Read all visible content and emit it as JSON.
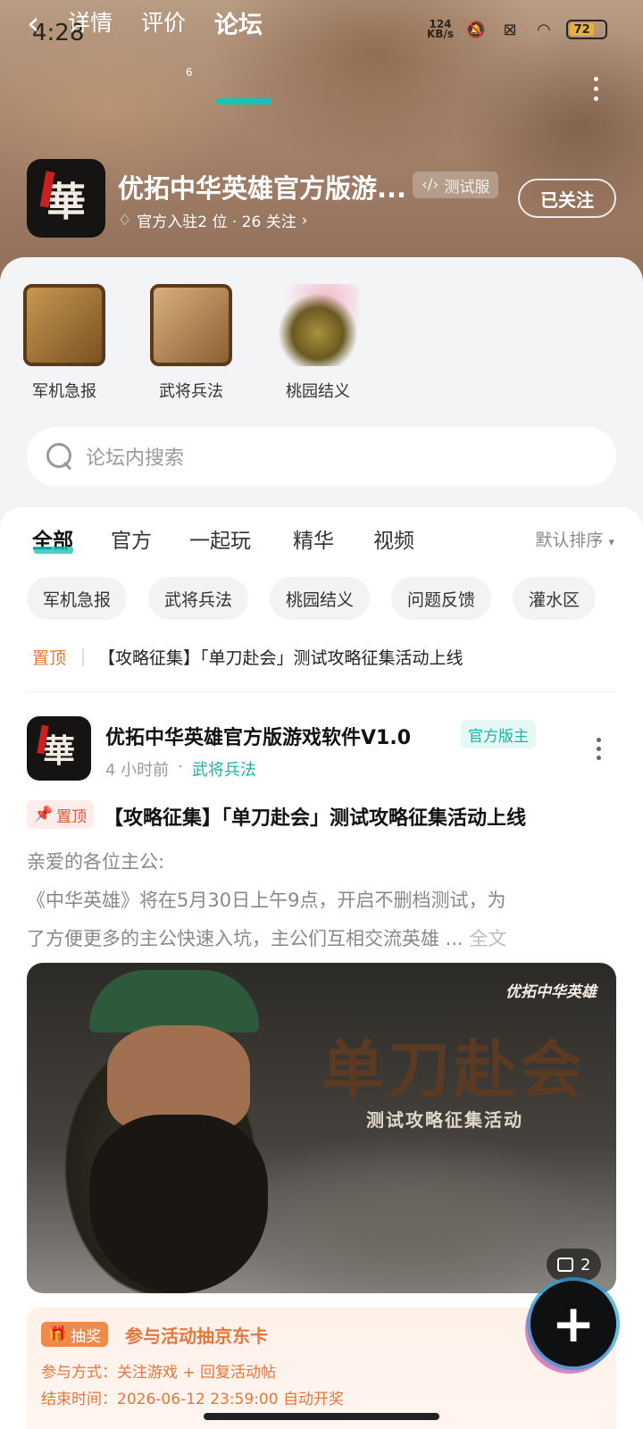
{
  "status": {
    "time": "4:28",
    "netspeed_top": "124",
    "netspeed_unit": "KB/s",
    "battery": "72"
  },
  "nav": {
    "tabs": [
      "详情",
      "评价",
      "论坛"
    ],
    "review_count": "6",
    "active_tab": "论坛"
  },
  "app": {
    "title": "优拓中华英雄官方版游...",
    "test_badge": "测试服",
    "follow_label": "已关注",
    "sub": "官方入驻2 位 · 26 关注",
    "logo_text": "華"
  },
  "quick_links": [
    {
      "label": "军机急报"
    },
    {
      "label": "武将兵法"
    },
    {
      "label": "桃园结义"
    }
  ],
  "search": {
    "placeholder": "论坛内搜索"
  },
  "filter_tabs": [
    "全部",
    "官方",
    "一起玩",
    "精华",
    "视频"
  ],
  "sort_label": "默认排序",
  "chips": [
    "军机急报",
    "武将兵法",
    "桃园结义",
    "问题反馈",
    "灌水区"
  ],
  "pinned": {
    "label": "置顶",
    "text": "【攻略征集】「单刀赴会」测试攻略征集活动上线"
  },
  "post": {
    "author": "优拓中华英雄官方版游戏软件V1.0",
    "owner_badge": "官方版主",
    "time": "4 小时前",
    "category": "武将兵法",
    "top_badge": "置顶",
    "title": "【攻略征集】「单刀赴会」测试攻略征集活动上线",
    "body_line1": "亲爱的各位主公:",
    "body_line2": "《中华英雄》将在5月30日上午9点，开启不删档测试，为",
    "body_line3": "了方便更多的主公快速入坑，主公们互相交流英雄 ...",
    "full_text": "全文",
    "banner_title": "单刀赴会",
    "banner_sub": "测试攻略征集活动",
    "banner_logo": "优拓中华英雄",
    "image_count": "2"
  },
  "lottery": {
    "badge": "抽奖",
    "title": "参与活动抽京东卡",
    "method": "参与方式：关注游戏 + 回复活动帖",
    "end": "结束时间：2026-06-12 23:59:00 自动开奖"
  },
  "colors": {
    "accent": "#19c3b4",
    "orange": "#e8763a"
  }
}
